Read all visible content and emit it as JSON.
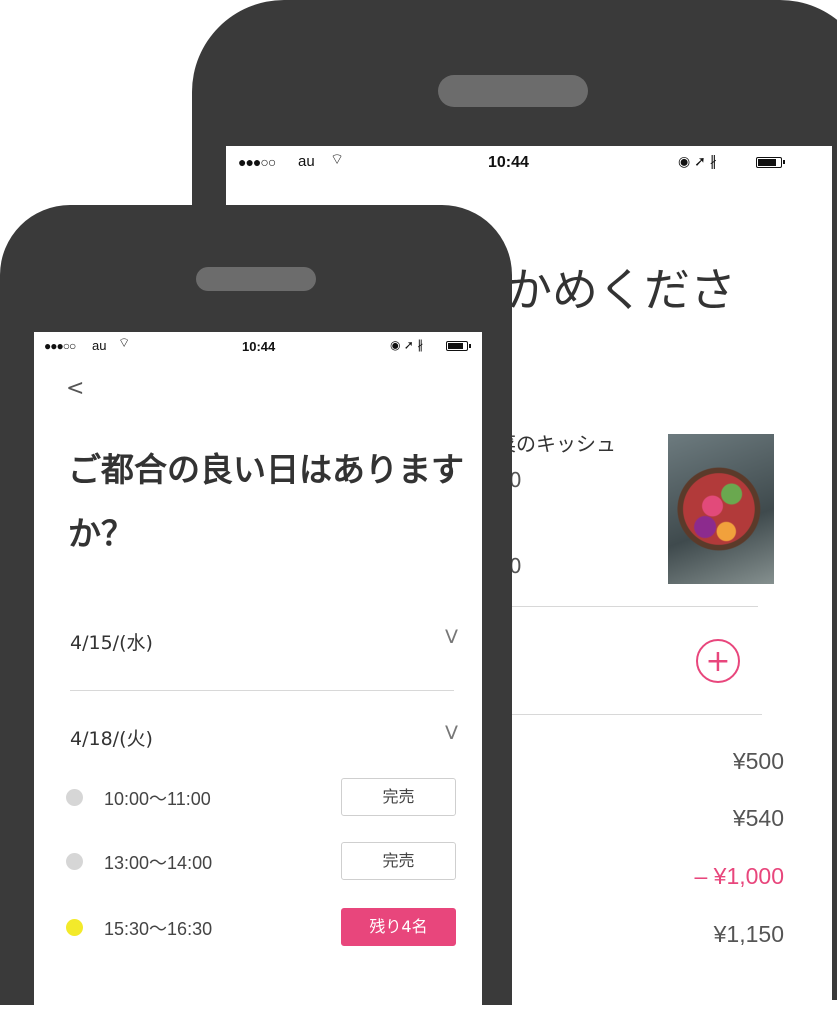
{
  "back_phone": {
    "status_bar": {
      "signal": "●●●○○",
      "carrier": "au",
      "wifi": "⌔",
      "time": "10:44",
      "icons": "◉ ➚ ∦"
    },
    "back_label": "<",
    "heading": "かめくださ",
    "item": {
      "title": "菜のキッシュ",
      "line1": "0",
      "line2": "0"
    },
    "add_icon": "+",
    "prices": [
      "¥500",
      "¥540",
      "– ¥1,000",
      "¥1,150"
    ],
    "accent_color": "#e8467c"
  },
  "front_phone": {
    "status_bar": {
      "signal": "●●●○○",
      "carrier": "au",
      "wifi": "⌔",
      "time": "10:44",
      "icons": "◉ ➚ ∦"
    },
    "back_label": "<",
    "title": "ご都合の良い日はありますか？",
    "dates": [
      {
        "label": "4/15/(水)",
        "chevron": "V"
      },
      {
        "label": "4/18/(火)",
        "chevron": "V"
      }
    ],
    "slots": [
      {
        "time": "10:00〜11:00",
        "status": "完売"
      },
      {
        "time": "13:00〜14:00",
        "status": "完売"
      },
      {
        "time": "15:30〜16:30",
        "status": "残り4名"
      }
    ]
  }
}
